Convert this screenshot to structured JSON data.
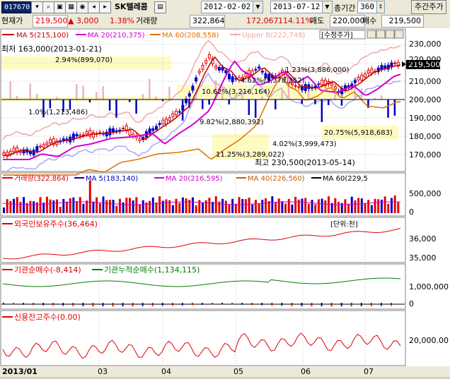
{
  "toolbar": {
    "code": "017670",
    "stock_name": "SK텔레콤",
    "start_date": "2012-02-02",
    "end_date": "2013-07-12",
    "period_label": "총기간",
    "period_value": "360",
    "weekly_button": "주간주가"
  },
  "quote": {
    "current_label": "현재가",
    "current_value": "219,500",
    "change": "▲ 3,000",
    "change_pct": "1.38%",
    "volume_label": "거래량",
    "volume_value": "322,864",
    "volume_prev": "172,067",
    "volume_ratio": "114.11%",
    "ask_label": "매도",
    "ask_value": "220,000",
    "bid_label": "매수",
    "bid_value": "219,500"
  },
  "colors": {
    "up": "#e00000",
    "down": "#0000c0",
    "ma5": "#c00000",
    "ma20": "#d000d0",
    "ma60": "#e07000",
    "ma40": "#c06000",
    "bollinger": "#f0a8a8",
    "cyan_lines": "#00b0b0"
  },
  "price_panel": {
    "legend": [
      {
        "label": "MA 5(215,100)",
        "color": "#c00000"
      },
      {
        "label": "MA 20(210,375)",
        "color": "#d000d0"
      },
      {
        "label": "MA 60(208,558)",
        "color": "#e07000"
      },
      {
        "label": "Upper B(222,748)",
        "color": "#f0a8a8"
      }
    ],
    "adjusted_label": "수정주가",
    "y_ticks": [
      "230,000",
      "220,000",
      "210,000",
      "200,000",
      "190,000",
      "180,000",
      "170,000"
    ],
    "current_price_tag": "219,500",
    "annotations": {
      "low_label": "최저 163,000(2013-01-21)",
      "high_label": "최고 230,500(2013-05-14)",
      "fib1": "2.94%(899,070)",
      "fib2": "1.0%(1,213,486)",
      "fib3": "10.62%(3,216,164)",
      "fib4": "4.62%(3,378,352)",
      "fib5": "1.23%(3,886,000)",
      "fib6": "9.82%(2,880,392)",
      "fib7": "20.75%(5,918,683)",
      "fib8": "4.02%(3,999,473)",
      "fib9": "11.25%(3,289,022)"
    }
  },
  "volume_panel": {
    "legend": [
      {
        "label": "거래량(322,864)",
        "color": "#e00000"
      },
      {
        "label": "MA 5(183,140)",
        "color": "#0000c0"
      },
      {
        "label": "MA 20(216,595)",
        "color": "#d000d0"
      },
      {
        "label": "MA 40(226,560)",
        "color": "#e07000"
      },
      {
        "label": "MA 60(229,5",
        "color": "#000000"
      }
    ],
    "y_ticks": [
      "500,000",
      "0"
    ]
  },
  "foreign_panel": {
    "legend": "외국인보유주수(36,464)",
    "unit_label": "[단위:천]",
    "y_ticks": [
      "36,000",
      "35,000"
    ]
  },
  "inst_panel": {
    "legend1": "기관순매수(-8,414)",
    "legend2": "기관누적순매수(1,134,115)",
    "y_ticks": [
      "1,000,000",
      "0"
    ]
  },
  "credit_panel": {
    "legend": "신용잔고주수(0.00)",
    "y_ticks": [
      "20,000.00"
    ]
  },
  "x_axis": {
    "labels": [
      "2013/01",
      "03",
      "04",
      "05",
      "06",
      "07"
    ]
  }
}
